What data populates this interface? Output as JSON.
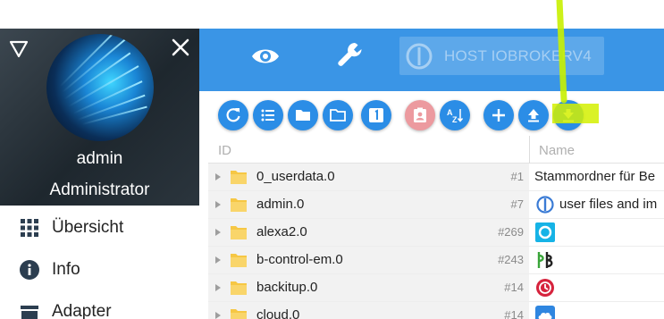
{
  "sidebar": {
    "user_name": "admin",
    "user_role": "Administrator",
    "nav": [
      {
        "label": "Übersicht",
        "icon": "grid-icon"
      },
      {
        "label": "Info",
        "icon": "info-icon"
      },
      {
        "label": "Adapter",
        "icon": "store-icon"
      }
    ]
  },
  "topbar": {
    "host_label": "HOST IOBROKERV4"
  },
  "table": {
    "header_id": "ID",
    "header_name": "Name",
    "rows": [
      {
        "id": "0_userdata.0",
        "num": "#1",
        "name": "Stammordner für Be",
        "icon": "none"
      },
      {
        "id": "admin.0",
        "num": "#7",
        "name": "user files and im",
        "icon": "iobroker-logo"
      },
      {
        "id": "alexa2.0",
        "num": "#269",
        "name": "",
        "icon": "alexa-icon"
      },
      {
        "id": "b-control-em.0",
        "num": "#243",
        "name": "",
        "icon": "b-control-icon"
      },
      {
        "id": "backitup.0",
        "num": "#14",
        "name": "",
        "icon": "backitup-icon"
      },
      {
        "id": "cloud.0",
        "num": "#14",
        "name": "",
        "icon": "cloud-icon"
      }
    ]
  },
  "colors": {
    "topbar": "#3a95e6",
    "button": "#2b8de6",
    "highlight": "#c8f000"
  }
}
